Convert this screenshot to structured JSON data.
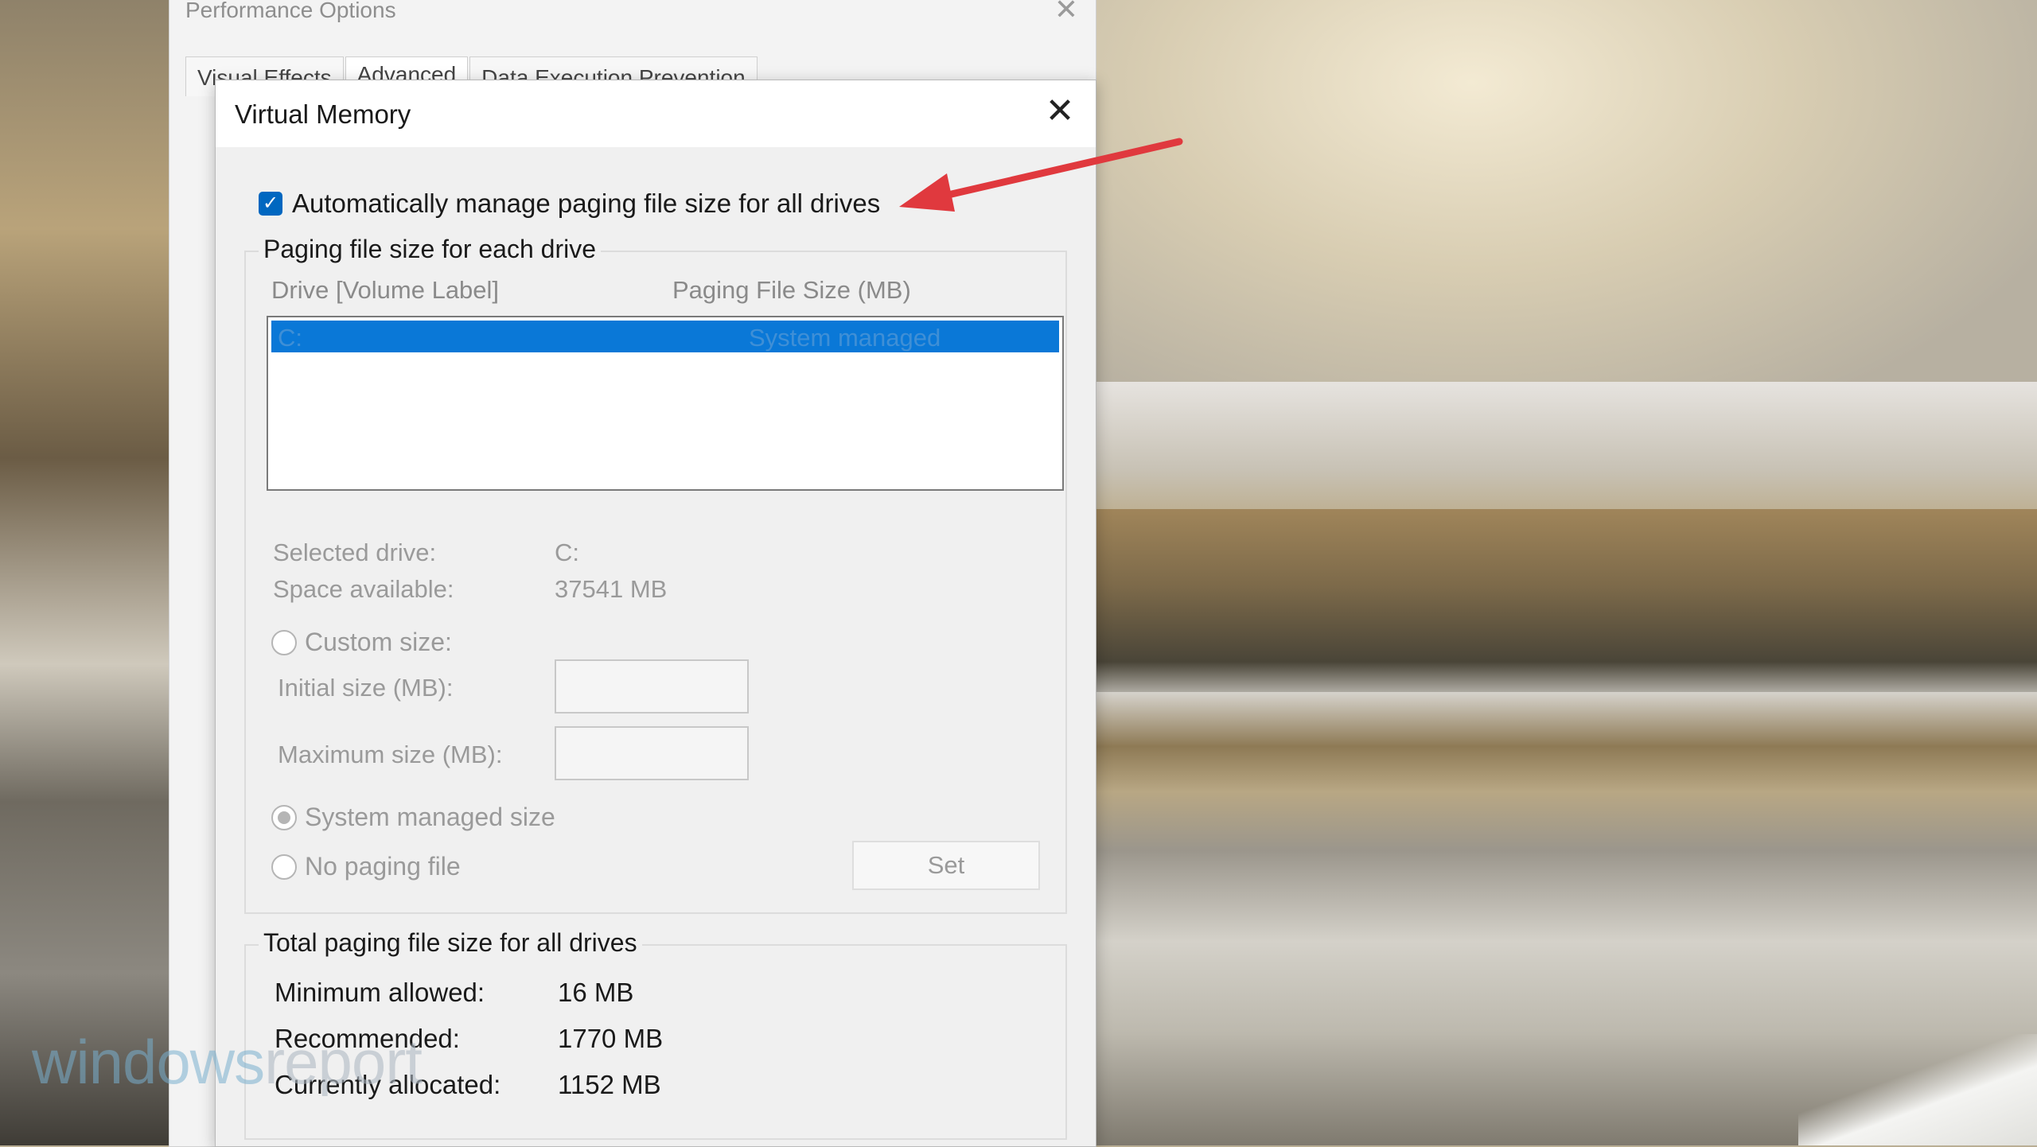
{
  "performance_window": {
    "title": "Performance Options",
    "tabs": [
      "Visual Effects",
      "Advanced",
      "Data Execution Prevention"
    ]
  },
  "dialog": {
    "title": "Virtual Memory",
    "auto_manage_label": "Automatically manage paging file size for all drives",
    "auto_manage_checked": true,
    "paging_group_title": "Paging file size for each drive",
    "list_headers": {
      "drive": "Drive  [Volume Label]",
      "size": "Paging File Size (MB)"
    },
    "drives": [
      {
        "drive": "C:",
        "size": "System managed"
      }
    ],
    "selected_drive_label": "Selected drive:",
    "selected_drive_value": "C:",
    "space_available_label": "Space available:",
    "space_available_value": "37541 MB",
    "custom_size_label": "Custom size:",
    "initial_size_label": "Initial size (MB):",
    "maximum_size_label": "Maximum size (MB):",
    "system_managed_label": "System managed size",
    "no_paging_label": "No paging file",
    "set_button": "Set",
    "total_group_title": "Total paging file size for all drives",
    "minimum_label": "Minimum allowed:",
    "minimum_value": "16 MB",
    "recommended_label": "Recommended:",
    "recommended_value": "1770 MB",
    "allocated_label": "Currently allocated:",
    "allocated_value": "1152 MB"
  },
  "watermark": {
    "part1": "windows",
    "part2": "report"
  },
  "colors": {
    "accent": "#0067c0",
    "selection": "#0a78d7",
    "arrow": "#e0393e"
  },
  "icons": {
    "close": "close-icon",
    "check": "checkmark-icon",
    "arrow": "red-arrow-annotation"
  }
}
